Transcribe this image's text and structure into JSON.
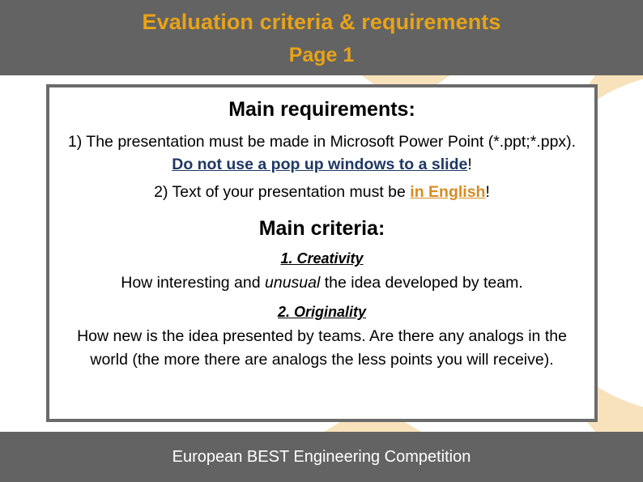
{
  "slide": {
    "header": {
      "title": "Evaluation criteria & requirements",
      "subtitle": "Page 1"
    },
    "footer": {
      "text": "European BEST Engineering Competition"
    },
    "body": {
      "requirements_heading": "Main requirements:",
      "requirement_1_part_a": "1) The presentation must be made in Microsoft Power Point (*.ppt;*.ppx). ",
      "requirement_1_highlight": "Do not use a pop up windows to a slide",
      "requirement_1_part_b": "!",
      "requirement_2_part_a": "2) Text of your presentation must be ",
      "requirement_2_highlight": "in English",
      "requirement_2_part_b": "!",
      "criteria_heading": "Main criteria:",
      "criterion_1_title": "1. Creativity",
      "criterion_1_text_a": "How interesting and ",
      "criterion_1_text_italic": "unusual",
      "criterion_1_text_b": " the idea developed by team.",
      "criterion_2_title": "2. Originality",
      "criterion_2_text": "How new is the idea presented by teams. Are there any analogs in the world (the more there are analogs the less points you will receive)."
    },
    "colors": {
      "band_gray": "#636363",
      "title_orange": "#E8A317",
      "accent_navy": "#1F3864",
      "accent_orange": "#D98B20",
      "decor_peach": "#F7E2BC",
      "box_border_gray": "#6B6B6B"
    }
  }
}
